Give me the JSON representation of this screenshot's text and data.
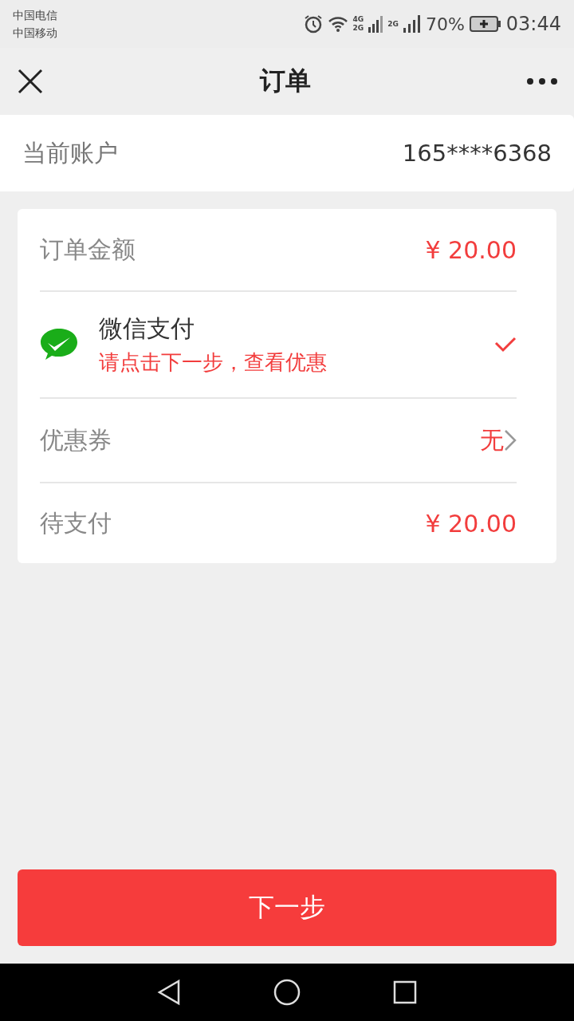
{
  "status_bar": {
    "carriers": [
      "中国电信",
      "中国移动"
    ],
    "network_labels": [
      "4G",
      "2G",
      "2G"
    ],
    "battery": "70%",
    "time": "03:44"
  },
  "nav": {
    "title": "订单"
  },
  "account": {
    "label": "当前账户",
    "value": "165****6368"
  },
  "order_rows": [
    {
      "kind": "amount",
      "label": "订单金额",
      "value": "¥ 20.00"
    },
    {
      "kind": "payment",
      "label": "微信支付",
      "note": "请点击下一步，查看优惠",
      "selected": true
    },
    {
      "kind": "coupon",
      "label": "优惠券",
      "value": "无"
    },
    {
      "kind": "amount",
      "label": "待支付",
      "value": "¥ 20.00"
    }
  ],
  "next_button": "下一步"
}
